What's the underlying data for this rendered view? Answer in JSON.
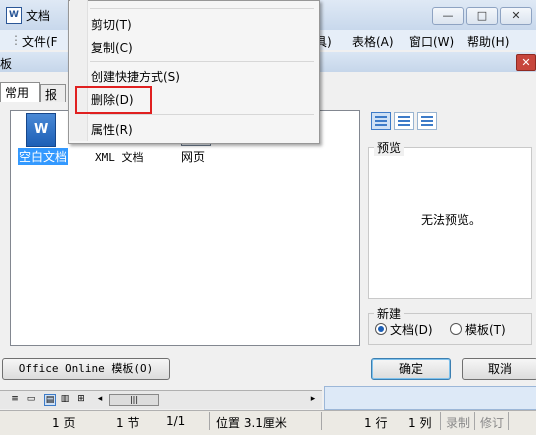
{
  "window": {
    "title": "文档",
    "min": "—",
    "max": "□",
    "close": "✕"
  },
  "menubar": {
    "file": "文件(F",
    "partial": "具)",
    "table": "表格(A)",
    "window": "窗口(W)",
    "help": "帮助(H)"
  },
  "dialog": {
    "title": "板",
    "close": "✕",
    "tabs": [
      "常用",
      "报"
    ],
    "files": [
      "空白文档",
      "XML 文档",
      "网页"
    ],
    "preview": {
      "title": "预览",
      "text": "无法预览。"
    },
    "new": {
      "title": "新建",
      "option_doc": "文档(D)",
      "option_template": "模板(T)",
      "selected": "文档(D)"
    },
    "buttons": {
      "office_online": "Office Online 模板(O)",
      "ok": "确定",
      "cancel": "取消"
    }
  },
  "context_menu": {
    "items": [
      "剪切(T)",
      "复制(C)",
      "创建快捷方式(S)",
      "删除(D)",
      "属性(R)"
    ],
    "highlighted": "删除(D)",
    "highlight_color": "#e02020"
  },
  "hscroll": {
    "icons": [
      "≡",
      "▭",
      "▤",
      "▥",
      "⊞",
      "◂",
      "▸"
    ],
    "thumb": "|||"
  },
  "status": {
    "page": "1 页",
    "section": "1 节",
    "page_of": "1/1",
    "position": "位置 3.1厘米",
    "line": "1 行",
    "column": "1 列",
    "record": "录制",
    "revise": "修订"
  }
}
